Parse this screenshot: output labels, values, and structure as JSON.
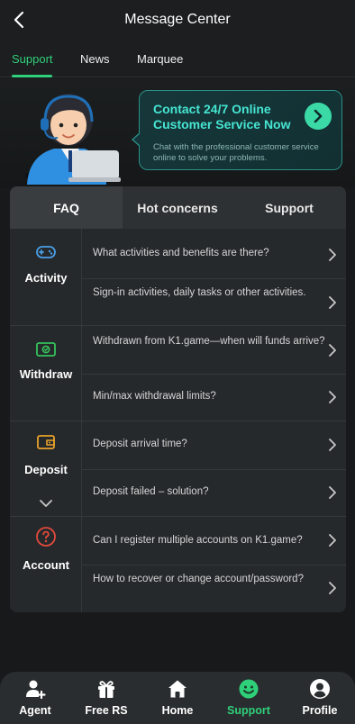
{
  "header": {
    "title": "Message Center",
    "back_icon": "chevron-left-icon"
  },
  "tabs": [
    {
      "label": "Support",
      "active": true
    },
    {
      "label": "News",
      "active": false
    },
    {
      "label": "Marquee",
      "active": false
    }
  ],
  "banner": {
    "title": "Contact 24/7 Online Customer Service Now",
    "description": "Chat with the professional customer service online to solve your problems.",
    "go_icon": "chevron-right-circle-icon"
  },
  "segments": [
    {
      "label": "FAQ",
      "active": true
    },
    {
      "label": "Hot concerns",
      "active": false
    },
    {
      "label": "Support",
      "active": false
    }
  ],
  "categories": [
    {
      "label": "Activity",
      "icon": "gamepad-icon",
      "color": "#4a9fe8",
      "questions": [
        "What activities and benefits are there?",
        "Sign-in activities, daily tasks or other activities."
      ]
    },
    {
      "label": "Withdraw",
      "icon": "cash-icon",
      "color": "#35c25a",
      "questions": [
        "Withdrawn from K1.game—when will funds arrive?",
        "Min/max withdrawal limits?"
      ]
    },
    {
      "label": "Deposit",
      "icon": "wallet-icon",
      "color": "#e8a12a",
      "questions": [
        "Deposit arrival time?",
        "Deposit failed – solution?"
      ]
    },
    {
      "label": "Account",
      "icon": "question-circle-icon",
      "color": "#e24a3c",
      "questions": [
        "Can I register multiple accounts on K1.game?",
        "How to recover or change account/password?"
      ]
    }
  ],
  "bottom_nav": [
    {
      "label": "Agent",
      "icon": "agent-icon",
      "active": false
    },
    {
      "label": "Free RS",
      "icon": "gift-icon",
      "active": false
    },
    {
      "label": "Home",
      "icon": "home-icon",
      "active": false
    },
    {
      "label": "Support",
      "icon": "support-smile-icon",
      "active": true
    },
    {
      "label": "Profile",
      "icon": "profile-icon",
      "active": false
    }
  ],
  "colors": {
    "accent": "#2fd07a",
    "banner_text": "#46e6d3"
  }
}
